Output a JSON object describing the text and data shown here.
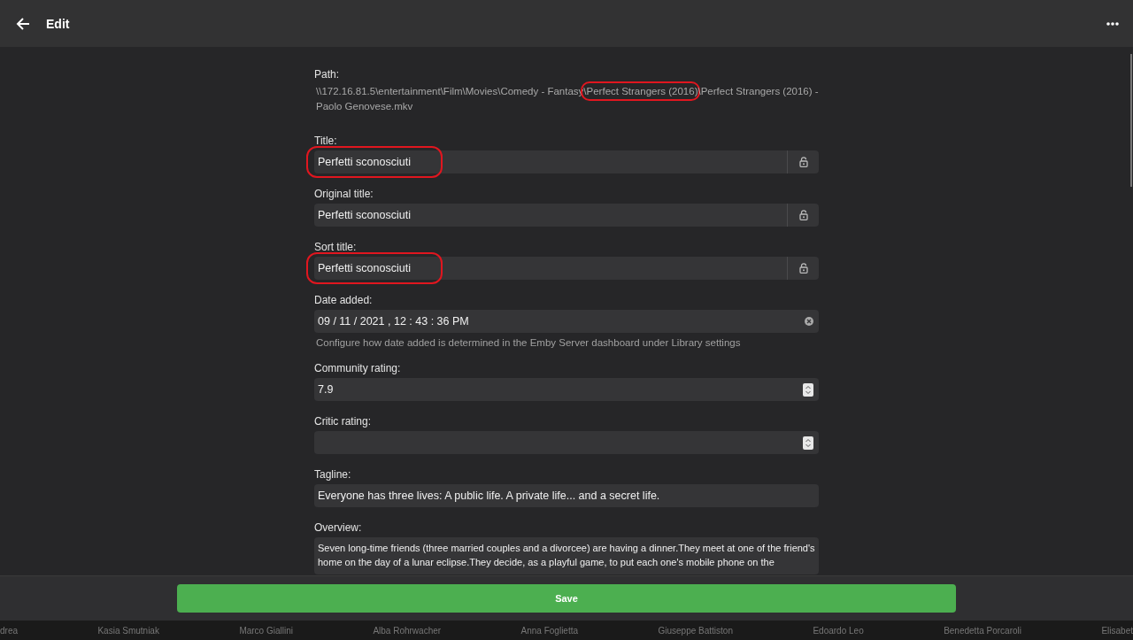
{
  "header": {
    "title": "Edit"
  },
  "path": {
    "label": "Path:",
    "segments": [
      {
        "text": "\\\\172.16.81.5\\entertainment\\Film\\Movies\\Comedy - Fantasy",
        "highlighted": false
      },
      {
        "text": "\\Perfect Strangers (2016)",
        "highlighted": true
      },
      {
        "text": "\\Perfect Strangers (2016) - Paolo Genovese.mkv",
        "highlighted": false
      }
    ]
  },
  "fields": [
    {
      "kind": "locked",
      "label": "Title:",
      "value": "Perfetti sconosciuti",
      "highlighted": true
    },
    {
      "kind": "locked",
      "label": "Original title:",
      "value": "Perfetti sconosciuti",
      "highlighted": false
    },
    {
      "kind": "locked",
      "label": "Sort title:",
      "value": "Perfetti sconosciuti",
      "highlighted": true
    },
    {
      "kind": "date",
      "label": "Date added:",
      "value": "09 / 11 / 2021 ,  12 : 43 : 36   PM",
      "hint": "Configure how date added is determined in the Emby Server dashboard under Library settings"
    },
    {
      "kind": "number",
      "label": "Community rating:",
      "value": "7.9"
    },
    {
      "kind": "number",
      "label": "Critic rating:"
    },
    {
      "kind": "text",
      "label": "Tagline:",
      "value": "Everyone has three lives: A public life. A private life... and a secret life."
    },
    {
      "kind": "textarea",
      "label": "Overview:",
      "value": "Seven long-time friends (three married couples and a divorcee) are having a dinner.They meet at one of the friend's home on the day of a lunar eclipse.They decide, as a playful game, to put each one's mobile phone on the"
    }
  ],
  "save_button": "Save",
  "cast_names": [
    "drea",
    "Kasia Smutniak",
    "Marco Giallini",
    "Alba Rohrwacher",
    "Anna Foglietta",
    "Giuseppe Battiston",
    "Edoardo Leo",
    "Benedetta Porcaroli",
    "Elisabet"
  ]
}
